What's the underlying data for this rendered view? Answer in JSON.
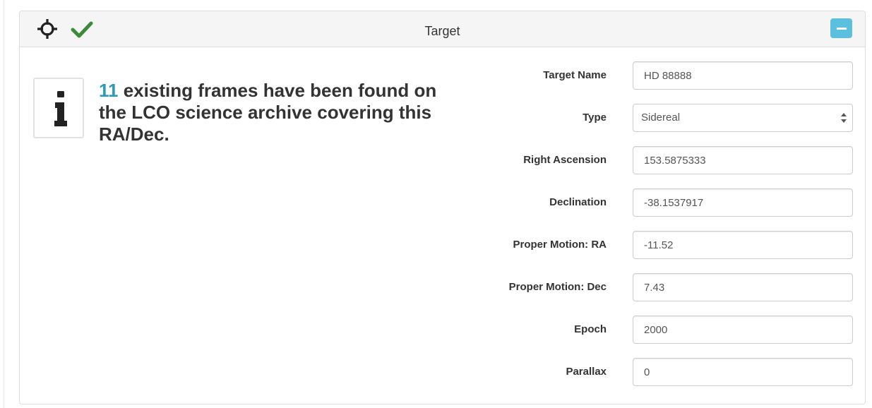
{
  "panel": {
    "title": "Target",
    "icons": {
      "crosshair": "crosshair-icon",
      "check": "check-icon",
      "collapse": "minus-icon"
    },
    "colors": {
      "check": "#3c8a3c",
      "collapse_button": "#5bc0de",
      "count_highlight": "#2a9bb8"
    }
  },
  "info": {
    "count": "11",
    "message": " existing frames have been found on the LCO science archive covering this RA/Dec."
  },
  "form": {
    "target_name": {
      "label": "Target Name",
      "value": "HD 88888"
    },
    "type": {
      "label": "Type",
      "value": "Sidereal"
    },
    "right_ascension": {
      "label": "Right Ascension",
      "value": "153.5875333"
    },
    "declination": {
      "label": "Declination",
      "value": "-38.1537917"
    },
    "proper_motion_ra": {
      "label": "Proper Motion: RA",
      "value": "-11.52"
    },
    "proper_motion_dec": {
      "label": "Proper Motion: Dec",
      "value": "7.43"
    },
    "epoch": {
      "label": "Epoch",
      "value": "2000"
    },
    "parallax": {
      "label": "Parallax",
      "value": "0"
    }
  }
}
